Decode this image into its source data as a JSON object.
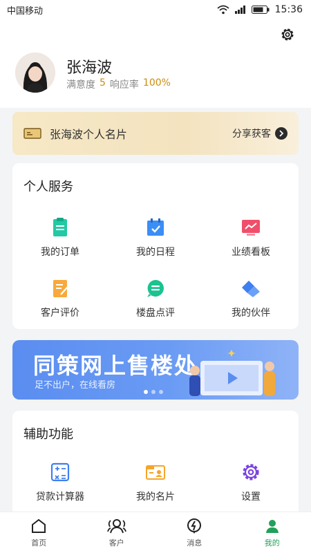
{
  "status": {
    "carrier": "中国移动",
    "time": "15:36"
  },
  "profile": {
    "name": "张海波",
    "satisfaction_label": "满意度",
    "satisfaction_value": "5",
    "response_label": "响应率",
    "response_value": "100%"
  },
  "card": {
    "title": "张海波个人名片",
    "share_label": "分享获客"
  },
  "services": {
    "title": "个人服务",
    "items": [
      {
        "label": "我的订单",
        "icon": "order-icon"
      },
      {
        "label": "我的日程",
        "icon": "calendar-icon"
      },
      {
        "label": "业绩看板",
        "icon": "chart-board-icon"
      },
      {
        "label": "客户评价",
        "icon": "review-icon"
      },
      {
        "label": "楼盘点评",
        "icon": "comment-icon"
      },
      {
        "label": "我的伙伴",
        "icon": "handshake-icon"
      }
    ]
  },
  "banner": {
    "title": "同策网上售楼处",
    "subtitle": "足不出户，在线看房"
  },
  "tools": {
    "title": "辅助功能",
    "items": [
      {
        "label": "贷款计算器",
        "icon": "calculator-icon"
      },
      {
        "label": "我的名片",
        "icon": "id-card-icon"
      },
      {
        "label": "设置",
        "icon": "settings-icon"
      }
    ]
  },
  "tabs": [
    {
      "label": "首页",
      "icon": "home-icon"
    },
    {
      "label": "客户",
      "icon": "customers-icon"
    },
    {
      "label": "消息",
      "icon": "message-icon"
    },
    {
      "label": "我的",
      "icon": "profile-icon"
    }
  ],
  "colors": {
    "accent": "#22a05a",
    "highlight": "#c98d10",
    "banner": "#5a8df0"
  }
}
